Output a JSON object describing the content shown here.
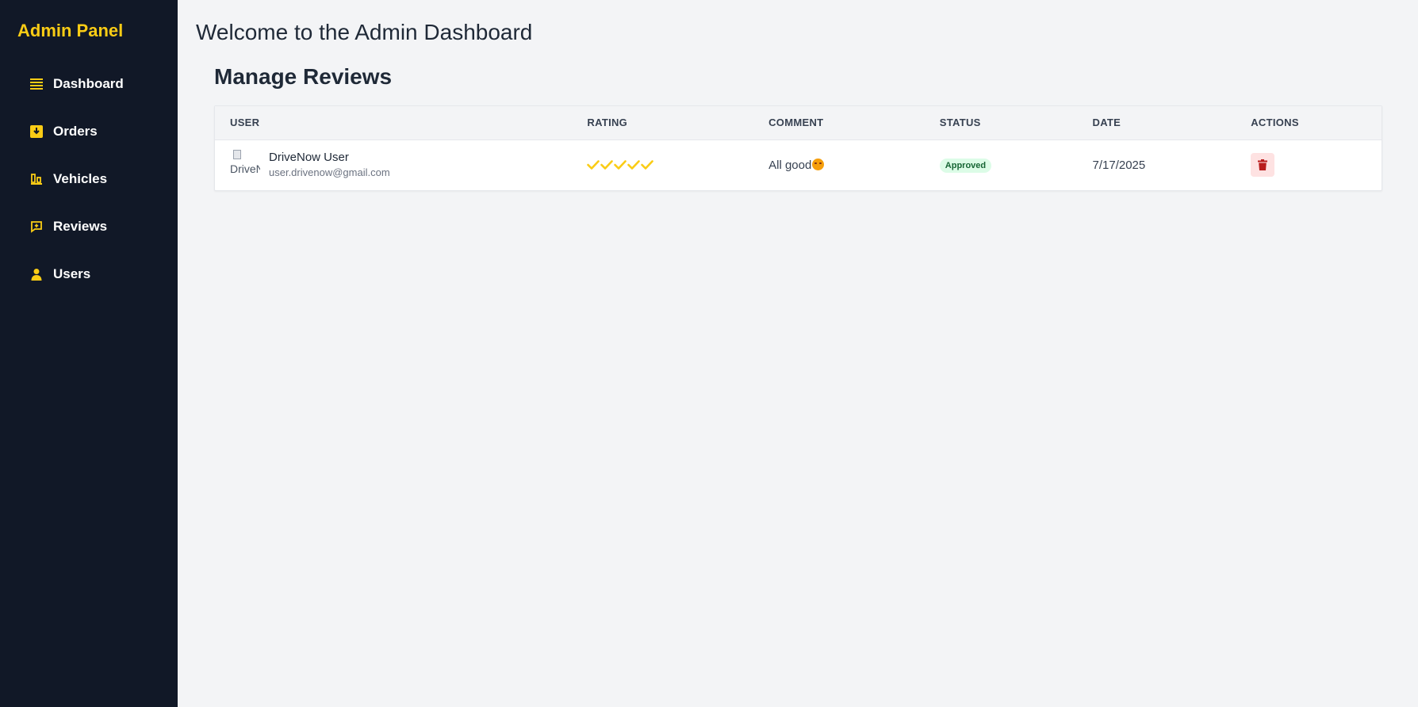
{
  "sidebar": {
    "brand": "Admin Panel",
    "items": [
      {
        "label": "Dashboard",
        "icon": "dashboard-icon"
      },
      {
        "label": "Orders",
        "icon": "orders-icon"
      },
      {
        "label": "Vehicles",
        "icon": "vehicles-icon"
      },
      {
        "label": "Reviews",
        "icon": "reviews-icon"
      },
      {
        "label": "Users",
        "icon": "users-icon"
      }
    ]
  },
  "header": {
    "title": "Welcome to the Admin Dashboard"
  },
  "reviews": {
    "title": "Manage Reviews",
    "columns": [
      "USER",
      "RATING",
      "COMMENT",
      "STATUS",
      "DATE",
      "ACTIONS"
    ],
    "rows": [
      {
        "avatar_alt": "DriveNow User",
        "name": "DriveNow User",
        "email": "user.drivenow@gmail.com",
        "rating": 5,
        "comment": "All good",
        "comment_emoji": "smiling-face-icon",
        "status": "Approved",
        "date": "7/17/2025",
        "action_icon": "trash-icon"
      }
    ]
  },
  "colors": {
    "accent": "#facc15",
    "sidebar_bg": "#111827",
    "status_approved_bg": "#dcfce7",
    "status_approved_text": "#166534",
    "delete_bg": "#fee2e2",
    "delete_icon": "#b91c1c"
  }
}
